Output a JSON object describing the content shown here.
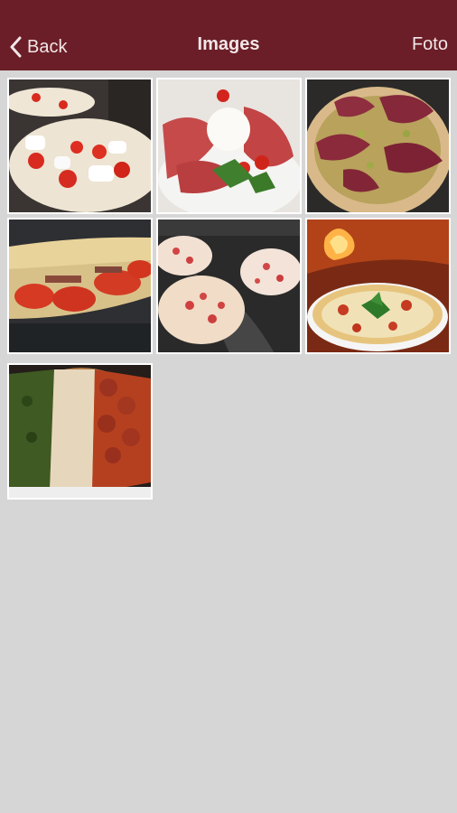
{
  "navbar": {
    "back_label": "Back",
    "title": "Images",
    "action_label": "Foto",
    "background_color": "#6b1e27",
    "text_color": "#f2e6e8"
  },
  "gallery": {
    "background_color": "#d6d6d6",
    "image_count": 7,
    "images": [
      {
        "subject": "pizza with cherry tomatoes and mozzarella"
      },
      {
        "subject": "burrata with prosciutto and tomatoes"
      },
      {
        "subject": "pizza with bresaola and pistachio"
      },
      {
        "subject": "folded flatbread with tomatoes"
      },
      {
        "subject": "raw pizzas on floured counter"
      },
      {
        "subject": "margherita pizza in wood-fired oven"
      },
      {
        "subject": "tricolore pizza"
      }
    ]
  }
}
